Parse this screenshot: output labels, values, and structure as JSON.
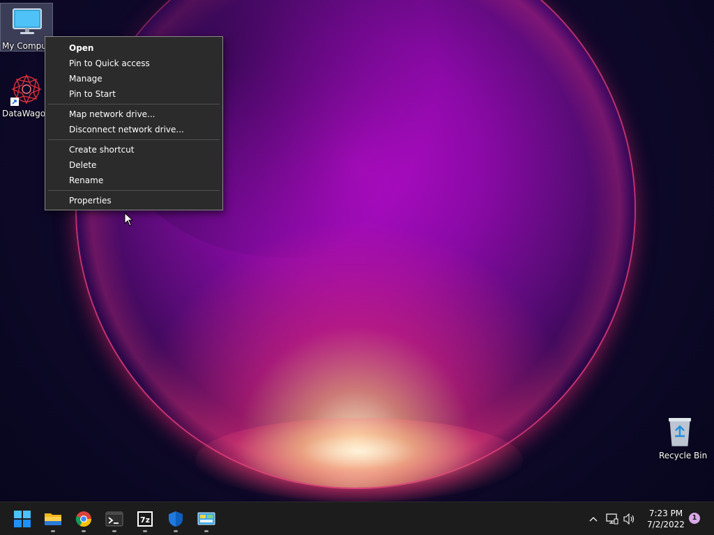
{
  "desktop": {
    "icons": [
      {
        "label": "My Comput",
        "icon": "monitor-icon"
      },
      {
        "label": "DataWagon",
        "icon": "datawagon-logo-icon"
      },
      {
        "label": "Recycle Bin",
        "icon": "recycle-bin-icon"
      }
    ]
  },
  "context_menu": {
    "groups": [
      [
        "Open",
        "Pin to Quick access",
        "Manage",
        "Pin to Start"
      ],
      [
        "Map network drive...",
        "Disconnect network drive..."
      ],
      [
        "Create shortcut",
        "Delete",
        "Rename"
      ],
      [
        "Properties"
      ]
    ],
    "default_item": "Open"
  },
  "taskbar": {
    "apps": [
      {
        "name": "start",
        "icon": "windows-start-icon",
        "running": false
      },
      {
        "name": "file-explorer",
        "icon": "folder-icon",
        "running": true
      },
      {
        "name": "chrome",
        "icon": "chrome-icon",
        "running": true
      },
      {
        "name": "terminal",
        "icon": "terminal-icon",
        "running": true
      },
      {
        "name": "7zip",
        "icon": "7zip-icon",
        "running": true
      },
      {
        "name": "defender",
        "icon": "shield-icon",
        "running": true
      },
      {
        "name": "control-panel",
        "icon": "control-panel-icon",
        "running": true
      }
    ],
    "tray": {
      "time": "7:23 PM",
      "date": "7/2/2022",
      "notification_count": "1"
    }
  },
  "colors": {
    "menu_bg": "#2b2b2b",
    "taskbar_bg": "#1c1c1c",
    "accent": "#0078d4"
  }
}
